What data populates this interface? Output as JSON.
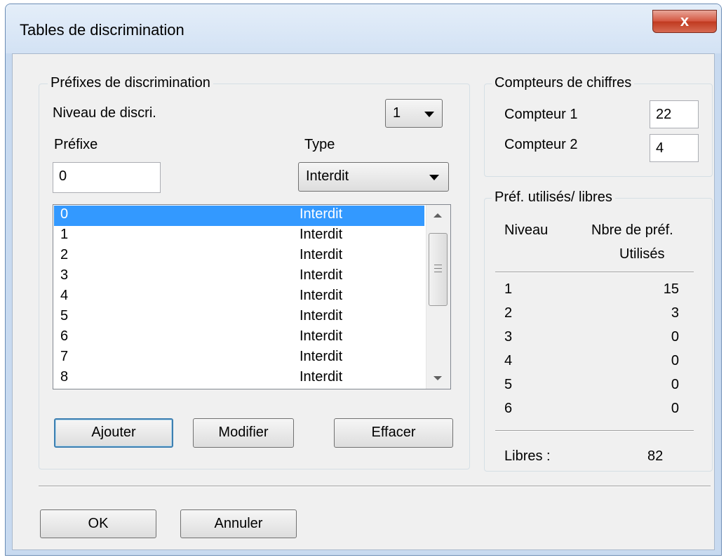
{
  "window": {
    "title": "Tables de discrimination",
    "close_label": "x"
  },
  "prefixes": {
    "group_title": "Préfixes de discrimination",
    "level_label": "Niveau de discri.",
    "level_value": "1",
    "prefix_label": "Préfixe",
    "prefix_value": "0",
    "type_label": "Type",
    "type_value": "Interdit",
    "list": [
      {
        "prefix": "0",
        "type": "Interdit"
      },
      {
        "prefix": "1",
        "type": "Interdit"
      },
      {
        "prefix": "2",
        "type": "Interdit"
      },
      {
        "prefix": "3",
        "type": "Interdit"
      },
      {
        "prefix": "4",
        "type": "Interdit"
      },
      {
        "prefix": "5",
        "type": "Interdit"
      },
      {
        "prefix": "6",
        "type": "Interdit"
      },
      {
        "prefix": "7",
        "type": "Interdit"
      },
      {
        "prefix": "8",
        "type": "Interdit"
      }
    ],
    "selected_index": 0,
    "buttons": {
      "add": "Ajouter",
      "modify": "Modifier",
      "delete": "Effacer"
    }
  },
  "counters": {
    "group_title": "Compteurs de chiffres",
    "counter1_label": "Compteur 1",
    "counter1_value": "22",
    "counter2_label": "Compteur 2",
    "counter2_value": "4"
  },
  "stats": {
    "group_title": "Préf. utilisés/ libres",
    "col_level": "Niveau",
    "col_count_line1": "Nbre de préf.",
    "col_count_line2": "Utilisés",
    "rows": [
      {
        "level": "1",
        "used": "15"
      },
      {
        "level": "2",
        "used": "3"
      },
      {
        "level": "3",
        "used": "0"
      },
      {
        "level": "4",
        "used": "0"
      },
      {
        "level": "5",
        "used": "0"
      },
      {
        "level": "6",
        "used": "0"
      }
    ],
    "free_label": "Libres :",
    "free_value": "82"
  },
  "footer": {
    "ok": "OK",
    "cancel": "Annuler"
  },
  "colors": {
    "selection": "#3399ff",
    "close_button": "#c8442c",
    "default_button_border": "#3c7fb1"
  }
}
